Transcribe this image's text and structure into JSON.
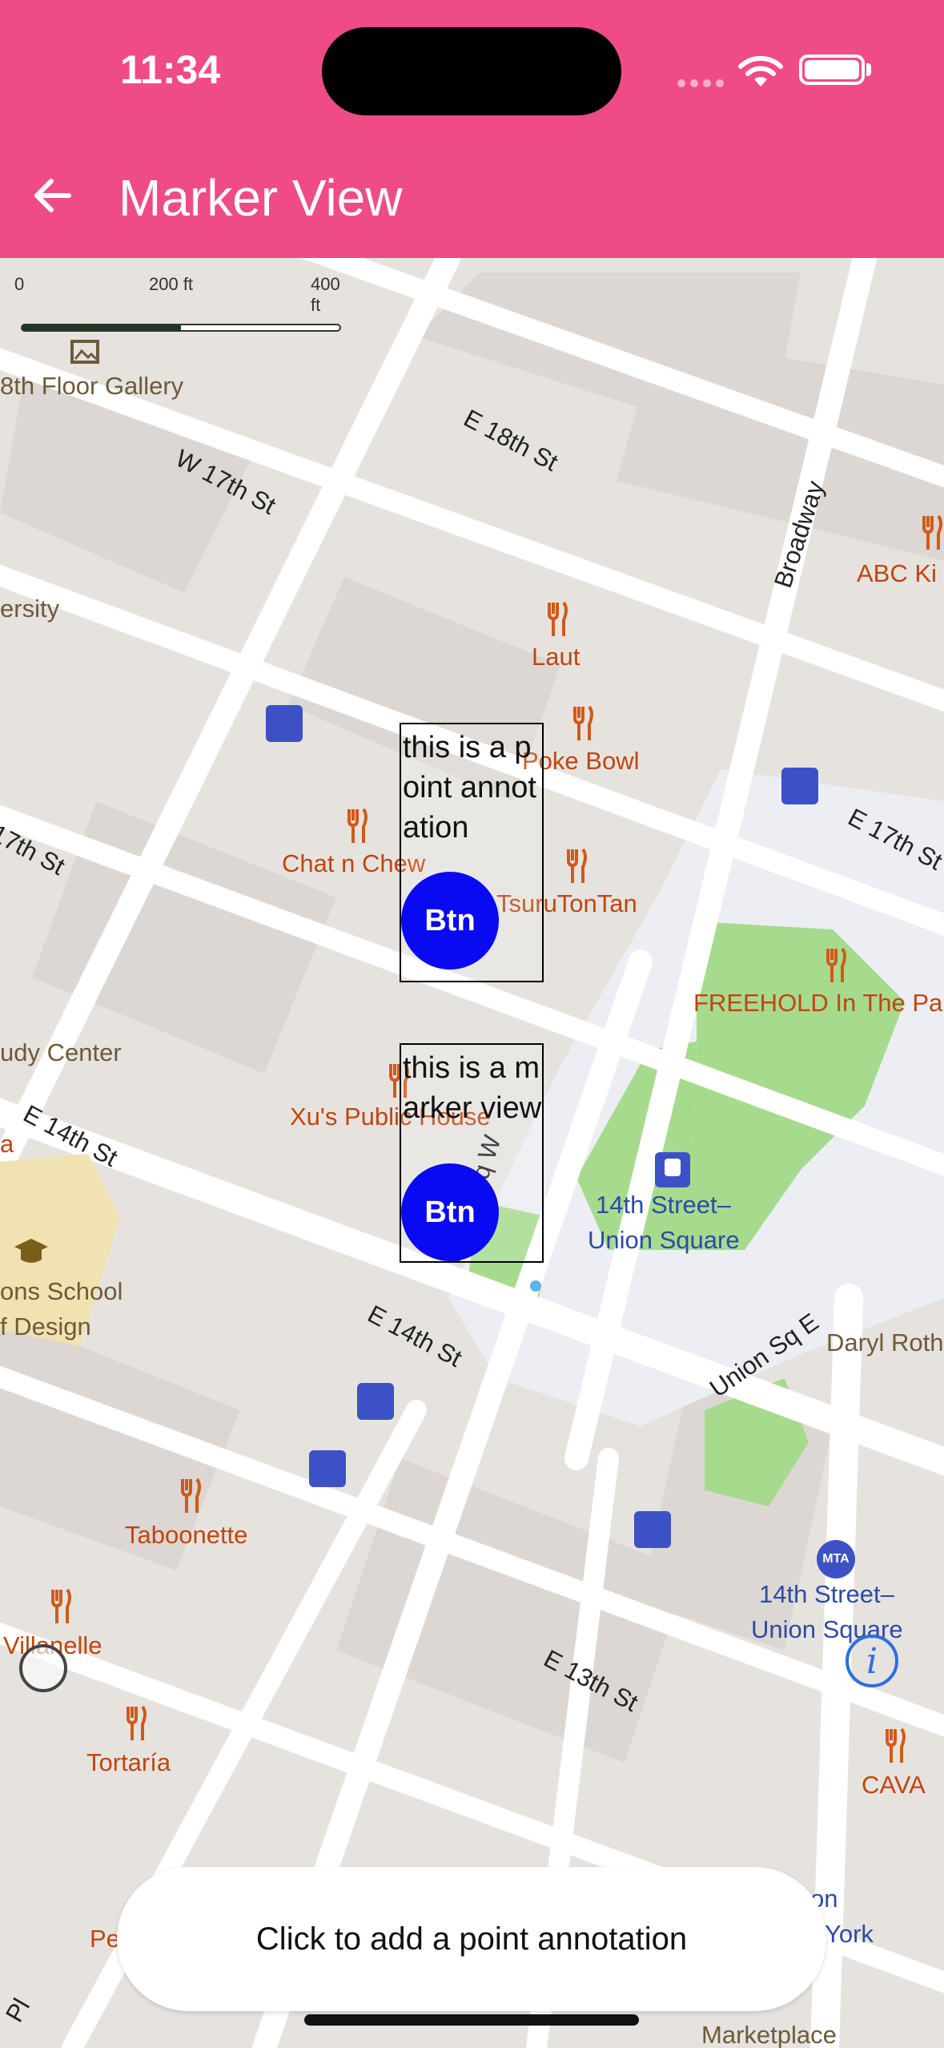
{
  "status_bar": {
    "time": "11:34"
  },
  "app_bar": {
    "title": "Marker View",
    "back_icon": "arrow-left-icon"
  },
  "map": {
    "scale": {
      "labels": [
        "0",
        "200 ft",
        "400 ft"
      ]
    },
    "streets": [
      "E 18th St",
      "W 17th St",
      "Broadway",
      "E 17th St",
      "E 14th St",
      "E 14th St",
      "Union Sq E",
      "E 13th St",
      "Union Sq W",
      "17th St",
      "Pl"
    ],
    "places": [
      "8th Floor Gallery",
      "ABC Ki",
      "ersity",
      "Laut",
      "Poke Bowl",
      "Chat n Chew",
      "TsuruTonTan",
      "FREEHOLD In The Pa",
      "udy Center",
      "Xu's Public House",
      "ons School",
      "f Design",
      "Daryl Roth",
      "Taboonette",
      "Villanelle",
      "Tortaría",
      "CAVA",
      "Marketplace",
      "on",
      "York",
      "Pe",
      "a"
    ],
    "transit": [
      "14th Street–",
      "Union Square",
      "14th Street–",
      "Union Square"
    ]
  },
  "annotations": [
    {
      "text": "this is a point annotation",
      "button": "Btn"
    },
    {
      "text": "this is a marker view",
      "button": "Btn"
    }
  ],
  "action": {
    "label": "Click to add a point annotation"
  },
  "colors": {
    "brand": "#ef4b87",
    "marker_button": "#0a0af2",
    "park": "#a6db8e",
    "poi": "#c0460f",
    "transit": "#2d4aa7"
  }
}
